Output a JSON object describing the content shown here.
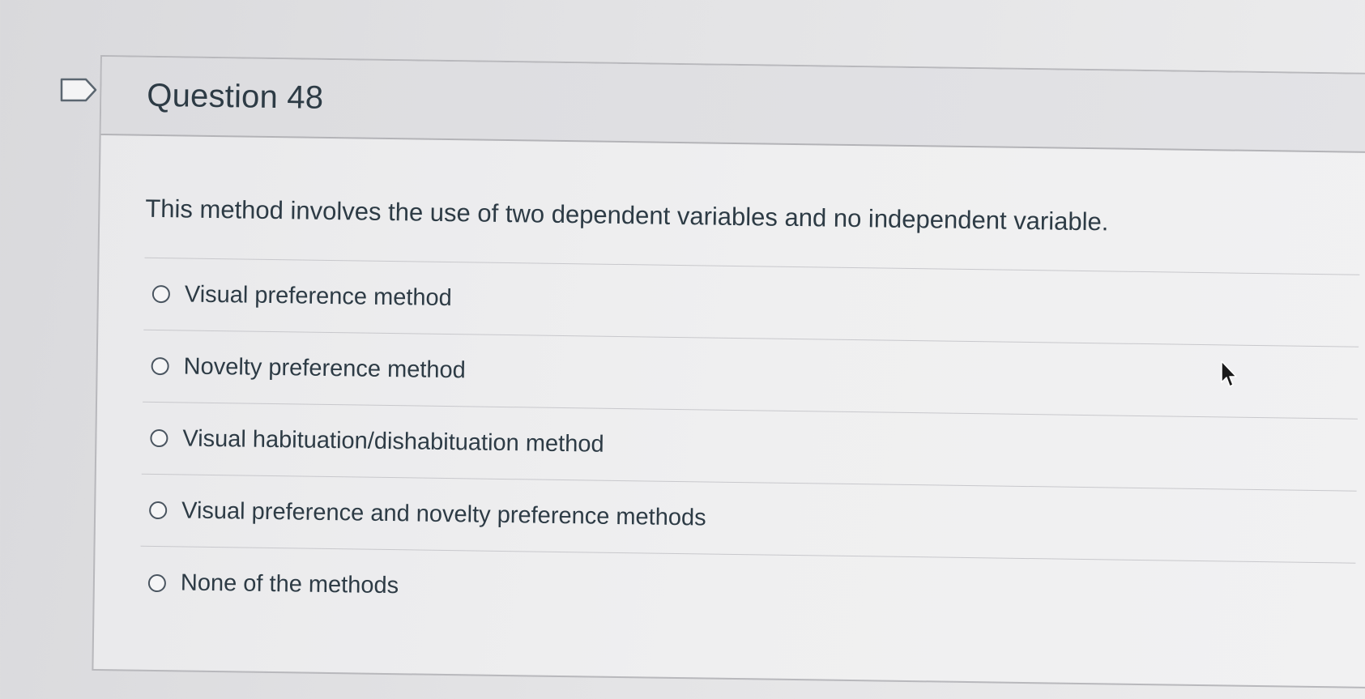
{
  "question": {
    "title": "Question 48",
    "text": "This method involves the use of two dependent variables and no independent variable."
  },
  "answers": [
    {
      "label": "Visual preference method",
      "selected": false
    },
    {
      "label": "Novelty preference method",
      "selected": false
    },
    {
      "label": "Visual habituation/dishabituation method",
      "selected": false
    },
    {
      "label": "Visual preference and novelty preference methods",
      "selected": false
    },
    {
      "label": "None of the methods",
      "selected": false
    }
  ],
  "icons": {
    "flag": "flag-question-icon",
    "cursor": "mouse-pointer-icon",
    "radio": "radio-unchecked-icon"
  },
  "colors": {
    "text": "#2d3b45",
    "border": "#b8b8bc",
    "header_bg": "#dcdcdf"
  }
}
